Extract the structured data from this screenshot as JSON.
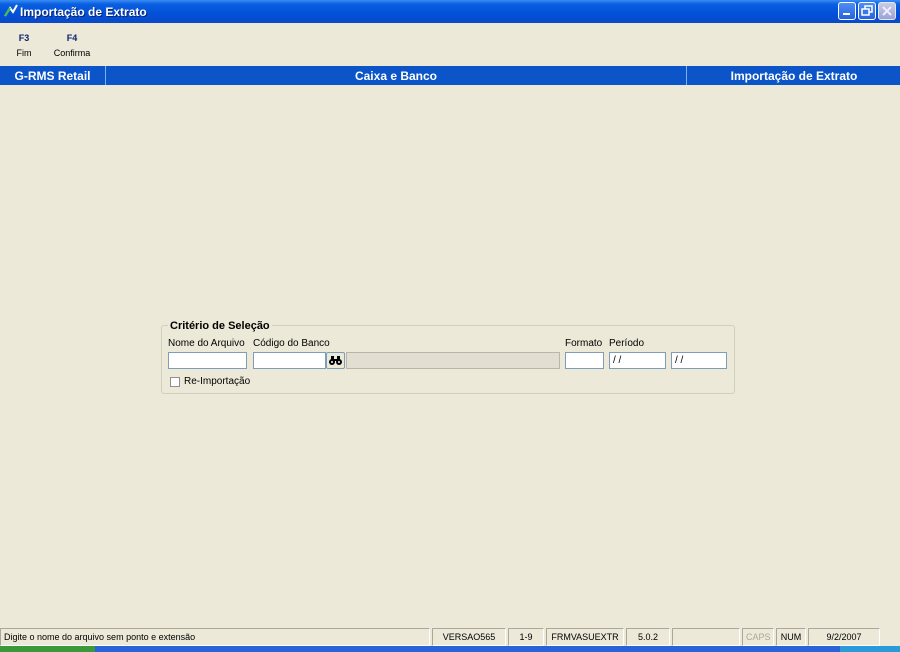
{
  "window": {
    "title": "Importação de Extrato",
    "icon": "app-icon"
  },
  "toolbar": {
    "items": [
      {
        "key": "F3",
        "label": "Fim"
      },
      {
        "key": "F4",
        "label": "Confirma"
      }
    ]
  },
  "header": {
    "system": "G-RMS Retail",
    "module": "Caixa e Banco",
    "screen": "Importação de Extrato"
  },
  "criteria": {
    "legend": "Critério de Seleção",
    "file_name_label": "Nome do Arquivo",
    "file_name_value": "",
    "bank_code_label": "Código do Banco",
    "bank_code_value": "",
    "bank_name_value": "",
    "format_label": "Formato",
    "format_value": "",
    "period_label": "Período",
    "period_start": " / /",
    "period_end": " / /",
    "reimport_label": "Re-Importação",
    "reimport_checked": false
  },
  "statusbar": {
    "message": "Digite o nome do arquivo sem ponto e extensão",
    "version": "VERSAO565",
    "range": "1-9",
    "form": "FRMVASUEXTR",
    "release": "5.0.2",
    "empty": "",
    "caps": "CAPS",
    "num": "NUM",
    "date": "9/2/2007"
  },
  "colors": {
    "titlebar": "#0350d8",
    "header": "#0c55c8",
    "background": "#ece9d8"
  }
}
